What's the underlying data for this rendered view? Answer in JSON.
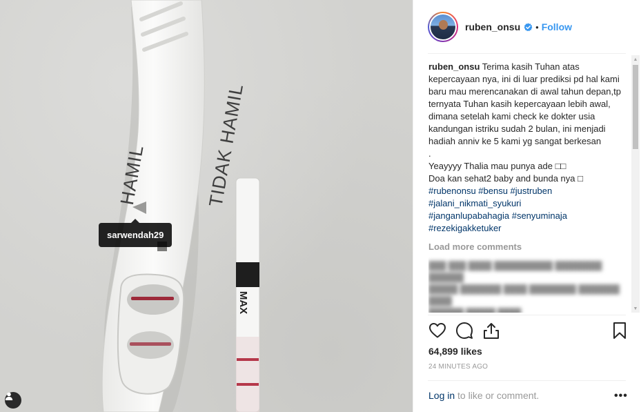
{
  "photo": {
    "test_labels": [
      "HAMIL",
      "TIDAK HAMIL"
    ],
    "strip_brand": "MAX",
    "tagged_user": "sarwendah29",
    "icons": {
      "tag_toggle": "user-tag-icon"
    }
  },
  "header": {
    "username": "ruben_onsu",
    "separator": "•",
    "follow_label": "Follow",
    "icons": {
      "verified": "verified-badge-icon"
    }
  },
  "caption": {
    "username": "ruben_onsu",
    "text": "Terima kasih Tuhan atas kepercayaan nya, ini di luar prediksi pd hal kami baru mau merencanakan di awal tahun depan,tp ternyata Tuhan kasih kepercayaan lebih awal, dimana setelah kami check ke dokter usia kandungan istriku sudah 2 bulan, ini menjadi hadiah anniv ke 5 kami yg sangat berkesan",
    "dot_line": ".",
    "line2": "Yeayyyy Thalia mau punya ade □□",
    "line3": "Doa kan sehat2 baby and bunda nya □",
    "hashtags": [
      "#rubenonsu #bensu #justruben",
      "#jalani_nikmati_syukuri",
      "#janganlupabahagia #senyuminaja",
      "#rezekigakketuker"
    ]
  },
  "load_more_label": "Load more comments",
  "actions": {
    "icons": [
      "heart-icon",
      "comment-icon",
      "share-icon",
      "bookmark-icon"
    ]
  },
  "likes": "64,899 likes",
  "timestamp": "24 MINUTES AGO",
  "login": {
    "link_label": "Log in",
    "rest_label": " to like or comment.",
    "more_label": "•••"
  },
  "colors": {
    "link_blue": "#3897f0",
    "hashtag_blue": "#003569",
    "muted": "#999999"
  }
}
